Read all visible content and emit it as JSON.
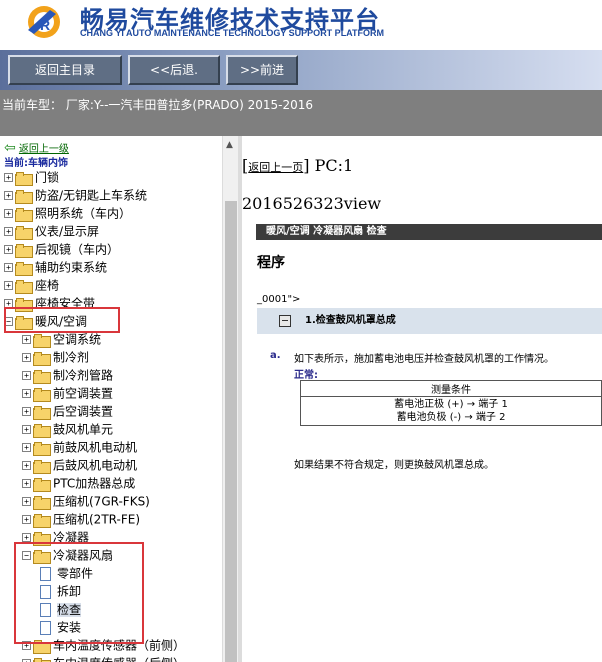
{
  "header": {
    "title_cn": "畅易汽车维修技术支持平台",
    "title_en": "CHANG YI AUTO MAINTENANCE TECHNOLOGY SUPPORT PLATFORM"
  },
  "nav": {
    "back_main": "返回主目录",
    "prev": "<<后退.",
    "next": ">>前进"
  },
  "vehicle_line": "当前车型： 厂家:Y--一汽丰田普拉多(PRADO) 2015-2016",
  "tree": {
    "back_up": "返回上一级",
    "current": "当前:车辆内饰",
    "items": [
      {
        "label": "门锁",
        "exp": "+",
        "level": 0
      },
      {
        "label": "防盗/无钥匙上车系统",
        "exp": "+",
        "level": 0
      },
      {
        "label": "照明系统（车内）",
        "exp": "+",
        "level": 0
      },
      {
        "label": "仪表/显示屏",
        "exp": "+",
        "level": 0
      },
      {
        "label": "后视镜（车内）",
        "exp": "+",
        "level": 0
      },
      {
        "label": "辅助约束系统",
        "exp": "+",
        "level": 0
      },
      {
        "label": "座椅",
        "exp": "+",
        "level": 0
      },
      {
        "label": "座椅安全带",
        "exp": "+",
        "level": 0
      },
      {
        "label": "暖风/空调",
        "exp": "-",
        "level": 0
      },
      {
        "label": "空调系统",
        "exp": "+",
        "level": 1
      },
      {
        "label": "制冷剂",
        "exp": "+",
        "level": 1
      },
      {
        "label": "制冷剂管路",
        "exp": "+",
        "level": 1
      },
      {
        "label": "前空调装置",
        "exp": "+",
        "level": 1
      },
      {
        "label": "后空调装置",
        "exp": "+",
        "level": 1
      },
      {
        "label": "鼓风机单元",
        "exp": "+",
        "level": 1
      },
      {
        "label": "前鼓风机电动机",
        "exp": "+",
        "level": 1
      },
      {
        "label": "后鼓风机电动机",
        "exp": "+",
        "level": 1
      },
      {
        "label": "PTC加热器总成",
        "exp": "+",
        "level": 1
      },
      {
        "label": "压缩机(7GR-FKS)",
        "exp": "+",
        "level": 1
      },
      {
        "label": "压缩机(2TR-FE)",
        "exp": "+",
        "level": 1
      },
      {
        "label": "冷凝器",
        "exp": "+",
        "level": 1
      },
      {
        "label": "冷凝器风扇",
        "exp": "-",
        "level": 1
      },
      {
        "label": "零部件",
        "exp": "",
        "level": 2
      },
      {
        "label": "拆卸",
        "exp": "",
        "level": 2
      },
      {
        "label": "检查",
        "exp": "",
        "level": 2
      },
      {
        "label": "安装",
        "exp": "",
        "level": 2
      },
      {
        "label": "车内温度传感器（前侧）",
        "exp": "+",
        "level": 1
      },
      {
        "label": "车内温度传感器（后侧）",
        "exp": "+",
        "level": 1
      }
    ]
  },
  "content": {
    "back_link": "返回上一页",
    "pc": "PC:1",
    "view_id": "2016526323view",
    "section": "暖风/空调  冷凝器风扇  检查",
    "procedure": "程序",
    "sub_code": "_0001\">",
    "step_title": "1.检查鼓风机罩总成",
    "step_a": "a.",
    "step_text": "如下表所示，施加蓄电池电压并检查鼓风机罩的工作情况。",
    "normal_label": "正常:",
    "table_header": "测量条件",
    "table_rows": [
      "蓄电池正极 (+) → 端子 1",
      "蓄电池负极 (-) → 端子 2"
    ],
    "result": "如果结果不符合规定，则更换鼓风机罩总成。"
  }
}
